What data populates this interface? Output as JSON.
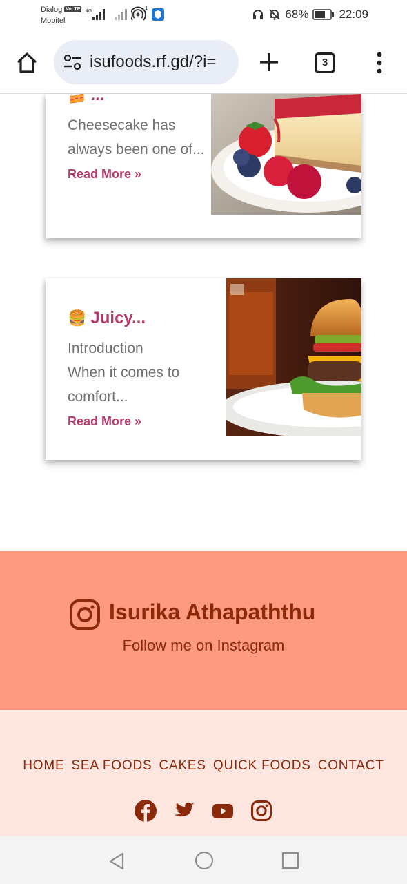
{
  "status_bar": {
    "carrier_1": "Dialog",
    "carrier_badge": "VoLTE",
    "carrier_2": "Mobitel",
    "network": "4G",
    "hotspot_count": "1",
    "battery_percent": "68%",
    "time": "22:09"
  },
  "browser": {
    "url": "isufoods.rf.gd/?i=",
    "tab_count": "3"
  },
  "cards": [
    {
      "emoji": "🍰",
      "title": "...",
      "excerpt": "Cheesecake has always been one of...",
      "read_more": "Read More »"
    },
    {
      "emoji": "🍔",
      "title": "Juicy...",
      "excerpt": "Introduction When it comes to comfort...",
      "read_more": "Read More »"
    }
  ],
  "instagram": {
    "name": "Isurika Athapaththu",
    "follow_text": "Follow me on Instagram"
  },
  "footer": {
    "nav": [
      "HOME",
      "SEA FOODS",
      "CAKES",
      "QUICK FOODS",
      "CONTACT"
    ],
    "social": [
      "facebook-icon",
      "twitter-icon",
      "youtube-icon",
      "instagram-icon"
    ]
  },
  "colors": {
    "accent": "#b33a6b",
    "banner": "#fe9a80",
    "footer_bg": "#fde6e0",
    "footer_text": "#8a2a0a"
  }
}
